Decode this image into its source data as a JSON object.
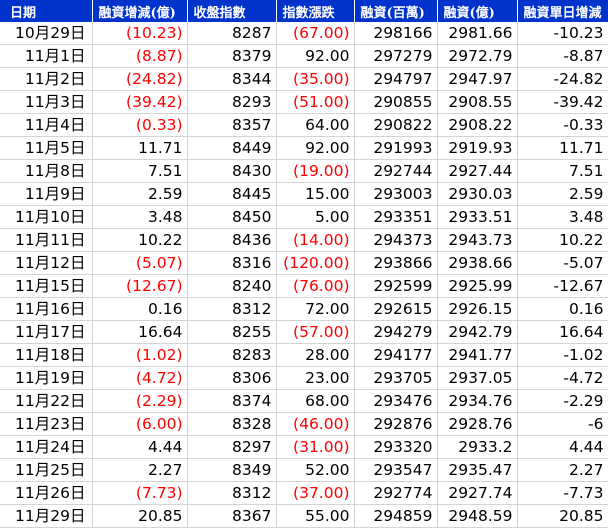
{
  "headers": [
    "日期",
    "融資增減(億)",
    "收盤指數",
    "指數漲跌",
    "融資(百萬)",
    "融資(億)",
    "融資單日增減"
  ],
  "colors": {
    "header_bg": "#0033cc",
    "header_text": "#ffffff",
    "negative": "#ff0000",
    "text": "#000000",
    "grid": "#d4d4d4"
  },
  "rows": [
    {
      "date": "10月29日",
      "chg": "(10.23)",
      "chg_neg": true,
      "close": "8287",
      "idx": "(67.00)",
      "idx_neg": true,
      "mil": "298166",
      "yi": "2981.66",
      "daily": "-10.23"
    },
    {
      "date": "11月1日",
      "chg": "(8.87)",
      "chg_neg": true,
      "close": "8379",
      "idx": "92.00",
      "idx_neg": false,
      "mil": "297279",
      "yi": "2972.79",
      "daily": "-8.87"
    },
    {
      "date": "11月2日",
      "chg": "(24.82)",
      "chg_neg": true,
      "close": "8344",
      "idx": "(35.00)",
      "idx_neg": true,
      "mil": "294797",
      "yi": "2947.97",
      "daily": "-24.82"
    },
    {
      "date": "11月3日",
      "chg": "(39.42)",
      "chg_neg": true,
      "close": "8293",
      "idx": "(51.00)",
      "idx_neg": true,
      "mil": "290855",
      "yi": "2908.55",
      "daily": "-39.42"
    },
    {
      "date": "11月4日",
      "chg": "(0.33)",
      "chg_neg": true,
      "close": "8357",
      "idx": "64.00",
      "idx_neg": false,
      "mil": "290822",
      "yi": "2908.22",
      "daily": "-0.33"
    },
    {
      "date": "11月5日",
      "chg": "11.71",
      "chg_neg": false,
      "close": "8449",
      "idx": "92.00",
      "idx_neg": false,
      "mil": "291993",
      "yi": "2919.93",
      "daily": "11.71"
    },
    {
      "date": "11月8日",
      "chg": "7.51",
      "chg_neg": false,
      "close": "8430",
      "idx": "(19.00)",
      "idx_neg": true,
      "mil": "292744",
      "yi": "2927.44",
      "daily": "7.51"
    },
    {
      "date": "11月9日",
      "chg": "2.59",
      "chg_neg": false,
      "close": "8445",
      "idx": "15.00",
      "idx_neg": false,
      "mil": "293003",
      "yi": "2930.03",
      "daily": "2.59"
    },
    {
      "date": "11月10日",
      "chg": "3.48",
      "chg_neg": false,
      "close": "8450",
      "idx": "5.00",
      "idx_neg": false,
      "mil": "293351",
      "yi": "2933.51",
      "daily": "3.48"
    },
    {
      "date": "11月11日",
      "chg": "10.22",
      "chg_neg": false,
      "close": "8436",
      "idx": "(14.00)",
      "idx_neg": true,
      "mil": "294373",
      "yi": "2943.73",
      "daily": "10.22"
    },
    {
      "date": "11月12日",
      "chg": "(5.07)",
      "chg_neg": true,
      "close": "8316",
      "idx": "(120.00)",
      "idx_neg": true,
      "mil": "293866",
      "yi": "2938.66",
      "daily": "-5.07"
    },
    {
      "date": "11月15日",
      "chg": "(12.67)",
      "chg_neg": true,
      "close": "8240",
      "idx": "(76.00)",
      "idx_neg": true,
      "mil": "292599",
      "yi": "2925.99",
      "daily": "-12.67"
    },
    {
      "date": "11月16日",
      "chg": "0.16",
      "chg_neg": false,
      "close": "8312",
      "idx": "72.00",
      "idx_neg": false,
      "mil": "292615",
      "yi": "2926.15",
      "daily": "0.16"
    },
    {
      "date": "11月17日",
      "chg": "16.64",
      "chg_neg": false,
      "close": "8255",
      "idx": "(57.00)",
      "idx_neg": true,
      "mil": "294279",
      "yi": "2942.79",
      "daily": "16.64"
    },
    {
      "date": "11月18日",
      "chg": "(1.02)",
      "chg_neg": true,
      "close": "8283",
      "idx": "28.00",
      "idx_neg": false,
      "mil": "294177",
      "yi": "2941.77",
      "daily": "-1.02"
    },
    {
      "date": "11月19日",
      "chg": "(4.72)",
      "chg_neg": true,
      "close": "8306",
      "idx": "23.00",
      "idx_neg": false,
      "mil": "293705",
      "yi": "2937.05",
      "daily": "-4.72"
    },
    {
      "date": "11月22日",
      "chg": "(2.29)",
      "chg_neg": true,
      "close": "8374",
      "idx": "68.00",
      "idx_neg": false,
      "mil": "293476",
      "yi": "2934.76",
      "daily": "-2.29"
    },
    {
      "date": "11月23日",
      "chg": "(6.00)",
      "chg_neg": true,
      "close": "8328",
      "idx": "(46.00)",
      "idx_neg": true,
      "mil": "292876",
      "yi": "2928.76",
      "daily": "-6"
    },
    {
      "date": "11月24日",
      "chg": "4.44",
      "chg_neg": false,
      "close": "8297",
      "idx": "(31.00)",
      "idx_neg": true,
      "mil": "293320",
      "yi": "2933.2",
      "daily": "4.44"
    },
    {
      "date": "11月25日",
      "chg": "2.27",
      "chg_neg": false,
      "close": "8349",
      "idx": "52.00",
      "idx_neg": false,
      "mil": "293547",
      "yi": "2935.47",
      "daily": "2.27"
    },
    {
      "date": "11月26日",
      "chg": "(7.73)",
      "chg_neg": true,
      "close": "8312",
      "idx": "(37.00)",
      "idx_neg": true,
      "mil": "292774",
      "yi": "2927.74",
      "daily": "-7.73"
    },
    {
      "date": "11月29日",
      "chg": "20.85",
      "chg_neg": false,
      "close": "8367",
      "idx": "55.00",
      "idx_neg": false,
      "mil": "294859",
      "yi": "2948.59",
      "daily": "20.85"
    }
  ]
}
